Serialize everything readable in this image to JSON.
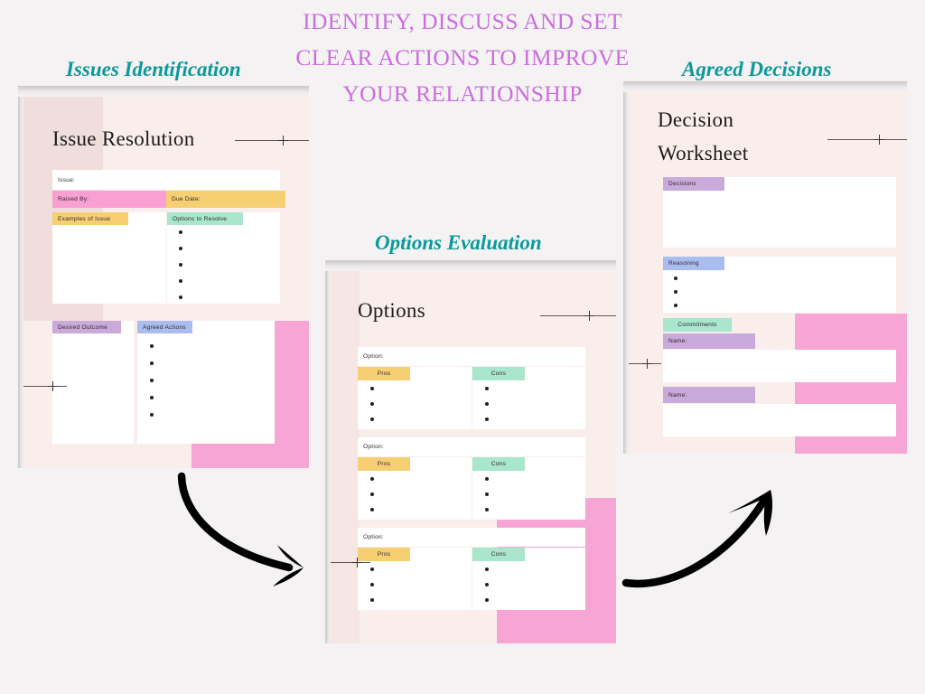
{
  "page": {
    "background": "#f4f2f3",
    "main_title_line1": "IDENTIFY, DISCUSS AND SET",
    "main_title_line2": "CLEAR ACTIONS TO IMPROVE",
    "main_title_line3": "YOUR RELATIONSHIP",
    "title_color": "#cc6ede",
    "label_color": "#099a9a",
    "accent_pink": "#f7a5d4",
    "card_bg": "#faeeec"
  },
  "sections": {
    "issues": "Issues Identification",
    "options": "Options Evaluation",
    "decisions": "Agreed Decisions"
  },
  "card_issue": {
    "title": "Issue Resolution",
    "fields": {
      "issue": "Issue:",
      "raised_by": "Raised By:",
      "due_date": "Due Date:",
      "examples": "Examples of Issue",
      "options_to_resolve": "Options to Resolve",
      "desired_outcome": "Desired Outcome",
      "agreed_actions": "Agreed Actions"
    },
    "colors": {
      "raised_by": "#f99fd2",
      "due_date": "#f6cf72",
      "examples": "#f6cf72",
      "options_to_resolve": "#a8e6cd",
      "desired_outcome": "#c9aada",
      "agreed_actions": "#a9bdf0"
    },
    "bullet_counts": {
      "options_to_resolve": 5,
      "agreed_actions": 5
    }
  },
  "card_options": {
    "title": "Options",
    "fields": {
      "option": "Option:",
      "pros": "Pros",
      "cons": "Cons"
    },
    "colors": {
      "pros": "#f6cf72",
      "cons": "#a8e6cd"
    },
    "rows": 3,
    "bullets_per_column": 3
  },
  "card_decision": {
    "title_line1": "Decision",
    "title_line2": "Worksheet",
    "fields": {
      "decisions": "Decisions",
      "reasoning": "Reasoning",
      "commitments": "Commitments",
      "name1": "Name:",
      "name2": "Name:"
    },
    "colors": {
      "decisions": "#c9aada",
      "reasoning": "#a9bdf0",
      "commitments": "#a8e6cd",
      "name": "#c9aada"
    },
    "bullet_counts": {
      "reasoning": 3
    }
  }
}
